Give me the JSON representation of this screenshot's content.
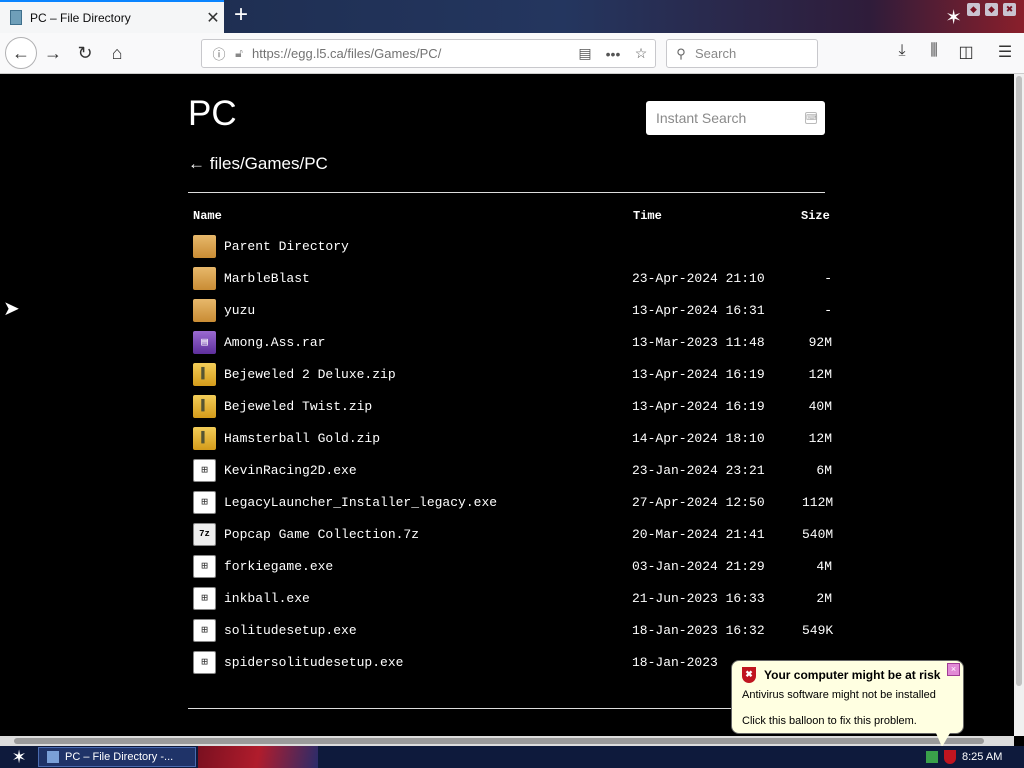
{
  "browser": {
    "tab_title": "PC – File Directory",
    "tab_close": "✕",
    "new_tab": "+",
    "url": "https://egg.l5.ca/files/Games/PC/",
    "search_placeholder": "Search"
  },
  "page": {
    "heading": "PC",
    "instant_search_placeholder": "Instant Search",
    "breadcrumb": "← files/Games/PC",
    "columns": {
      "name": "Name",
      "time": "Time",
      "size": "Size"
    },
    "rows": [
      {
        "name": "Parent Directory",
        "time": "",
        "size": "",
        "icon": "folder"
      },
      {
        "name": "MarbleBlast",
        "time": "23-Apr-2024 21:10",
        "size": "-",
        "icon": "folder"
      },
      {
        "name": "yuzu",
        "time": "13-Apr-2024 16:31",
        "size": "-",
        "icon": "folder"
      },
      {
        "name": "Among.Ass.rar",
        "time": "13-Mar-2023 11:48",
        "size": "92M",
        "icon": "rar"
      },
      {
        "name": "Bejeweled 2 Deluxe.zip",
        "time": "13-Apr-2024 16:19",
        "size": "12M",
        "icon": "zip"
      },
      {
        "name": "Bejeweled Twist.zip",
        "time": "13-Apr-2024 16:19",
        "size": "40M",
        "icon": "zip"
      },
      {
        "name": "Hamsterball Gold.zip",
        "time": "14-Apr-2024 18:10",
        "size": "12M",
        "icon": "zip"
      },
      {
        "name": "KevinRacing2D.exe",
        "time": "23-Jan-2024 23:21",
        "size": "6M",
        "icon": "exe"
      },
      {
        "name": "LegacyLauncher_Installer_legacy.exe",
        "time": "27-Apr-2024 12:50",
        "size": "112M",
        "icon": "exe"
      },
      {
        "name": "Popcap Game Collection.7z",
        "time": "20-Mar-2024 21:41",
        "size": "540M",
        "icon": "7z"
      },
      {
        "name": "forkiegame.exe",
        "time": "03-Jan-2024 21:29",
        "size": "4M",
        "icon": "exe"
      },
      {
        "name": "inkball.exe",
        "time": "21-Jun-2023 16:33",
        "size": "2M",
        "icon": "exe"
      },
      {
        "name": "solitudesetup.exe",
        "time": "18-Jan-2023 16:32",
        "size": "549K",
        "icon": "exe"
      },
      {
        "name": "spidersolitudesetup.exe",
        "time": "18-Jan-2023 ",
        "size": "",
        "icon": "exe"
      }
    ]
  },
  "balloon": {
    "title": "Your computer might be at risk",
    "line1": "Antivirus software might not be installed",
    "line2": "Click this balloon to fix this problem.",
    "close": "×"
  },
  "taskbar": {
    "task_label": "PC – File Directory -...",
    "clock": "8:25 AM"
  }
}
